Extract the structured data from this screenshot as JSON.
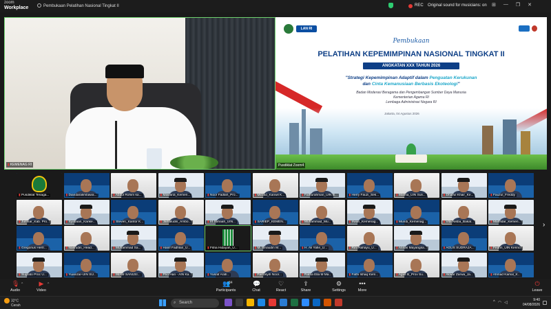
{
  "titlebar": {
    "logo_top": "zoom",
    "logo_bottom": "Workplace",
    "title": "Pembukaan Pelatihan Nasional Tingkat II",
    "rec": "REC",
    "original_sound": "Original sound for musicians: on",
    "accent_rec": "#e53935"
  },
  "speaker": {
    "name": "KEMENAG RI"
  },
  "slide": {
    "logo_text": "LAN RI",
    "top": "Pembukaan",
    "title": "PELATIHAN KEPEMIMPINAN NASIONAL TINGKAT II",
    "sub": "ANGKATAN XXX TAHUN 2026",
    "theme1_a": "\"Strategi Kepemimpinan Adaptif dalam ",
    "theme1_b": "Penguatan Kerukunan",
    "theme2_a": "dan ",
    "theme2_b": "Cinta Kemanusiaan Berbasis Ekoteologi",
    "theme2_c": "\"",
    "org1": "Badan Moderasi Beragama dan Pengembangan Sumber Daya Manusia",
    "org2": "Kementerian Agama RI",
    "org3": "Lembaga Administrasi Negara RI",
    "place": "Jakarta, 04 Agustus 2026",
    "name": "Pusdiklat Zoom4"
  },
  "gallery": [
    "Pusdiklat Tenaga...",
    "Diandaralimbawa...",
    "Abdul Rohim ka...",
    "Mawardi_Kemen...",
    "Noor Fadlah_Pro...",
    "Mirzad_Kanwil K...",
    "Fathurahman_UIN B...",
    "Herry Fauzi_Sek...",
    "Mahsa_UIN Suli...",
    "Dhaiful Khair_Ke...",
    "Fauzul_Freddy",
    "Jumsar_Kab. Pro...",
    "Syabaan_Kanke...",
    "Steven_Kantor K...",
    "Jamaludin_Ambo...",
    "Irt Sahaah_UIN...",
    "SARIEP_KEMEN...",
    "Muhammad_Mu...",
    "Irwan_Kemenag...",
    "Mundi_Kemenag...",
    "Vita Nisba_Bakal...",
    "Mahfidar_Kemen...",
    "Gregorius Hertr...",
    "Nasrudin_Head...",
    "Muhammad Sa...",
    "Hanif Fadhlan_U...",
    "Fitria Hidayah_U...",
    "M. Sinaudin M...",
    "H. Ali Yafie_U...",
    "Rini Rahayu_U...",
    "Annas Mayangsa...",
    "AGUS SUDRAJA...",
    "Fedrin_UIN Kerinci",
    "Sugrato Proc U...",
    "Yuanizar-UIN SU...",
    "IMAM SANUSI...",
    "Prio Han - AIN Ka...",
    "Yusraf Arafi...",
    "Farrosyih Noor...",
    "Ratna Ella M Ma...",
    "Fathi Ishaq Kem...",
    "Agus B_Prov Su...",
    "Akwar Zarwa_Ja...",
    "Ahmad Kamal_K..."
  ],
  "toolbar": {
    "audio": "Audio",
    "video": "Video",
    "participants": "Participants",
    "participants_count": "84",
    "chat": "Chat",
    "react": "React",
    "share": "Share",
    "settings": "Settings",
    "more": "More",
    "leave": "Leave"
  },
  "taskbar": {
    "temp": "32°C",
    "weather": "Cerah",
    "search": "Search",
    "time": "9:40",
    "date": "04/08/2026"
  }
}
